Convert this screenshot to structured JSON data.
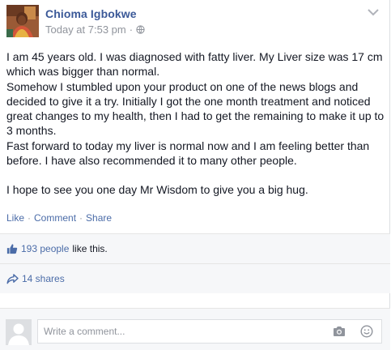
{
  "post": {
    "author": "Chioma Igbokwe",
    "timestamp": "Today at 7:53 pm",
    "separator": "·",
    "audience_icon": "globe-icon",
    "menu_icon": "chevron-down-icon",
    "paragraphs": [
      "I am 45 years old. I was diagnosed with fatty liver. My Liver size was 17 cm which was bigger than normal.",
      "Somehow I stumbled upon your product on one of the news blogs and decided to give it a try. Initially I got the one month treatment and noticed great changes to my health, then I had to get the remaining to make it up to 3 months.",
      "Fast forward to today my liver is normal now and I am feeling better than before. I have also recommended it to many other people.",
      "I hope to see you one day Mr Wisdom to give you a big hug."
    ]
  },
  "actions": {
    "like": "Like",
    "comment": "Comment",
    "share": "Share",
    "dot": "·"
  },
  "likes": {
    "icon": "thumbs-up-icon",
    "count": "193 people",
    "suffix": "like this."
  },
  "shares": {
    "icon": "share-arrow-icon",
    "label": "14 shares"
  },
  "comment_box": {
    "placeholder": "Write a comment...",
    "camera_icon": "camera-icon",
    "emoji_icon": "smiley-icon"
  },
  "colors": {
    "link": "#3b5998",
    "muted": "#90949c",
    "band_bg": "#f6f7f9"
  }
}
